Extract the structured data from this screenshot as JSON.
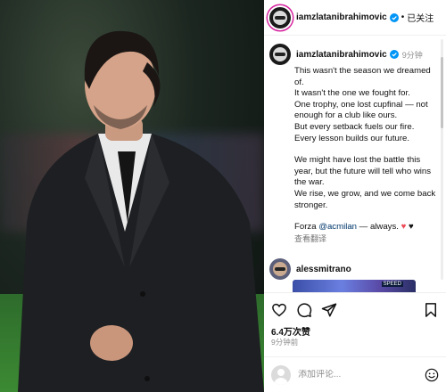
{
  "header": {
    "username": "iamzlatanibrahimovic",
    "separator": "•",
    "follow_label": "已关注"
  },
  "caption": {
    "username": "iamzlatanibrahimovic",
    "time_ago": "9分钟",
    "lines": [
      "This wasn't the season we dreamed of.",
      "It wasn't the one we fought for.",
      "One trophy, one lost cupfinal — not enough for a club like ours.",
      "But every setback fuels our fire. Every lesson builds our future.",
      "We might have lost the battle this year, but the future will tell who wins the war.",
      "We rise, we grow, and we come back stronger."
    ],
    "closing_prefix": "Forza ",
    "closing_mention": "@acmilan",
    "closing_suffix": " — always. ",
    "heart_red": "♥",
    "heart_black": "♥",
    "translate_label": "查看翻译"
  },
  "comment": {
    "username": "alessmitrano"
  },
  "stats": {
    "likes": "6.4万次赞",
    "posted_ago": "9分钟前"
  },
  "composer": {
    "placeholder": "添加评论..."
  },
  "icons": {
    "like": "heart-icon",
    "comment": "comment-icon",
    "share": "share-icon",
    "save": "bookmark-icon",
    "emoji": "emoji-icon",
    "verified": "verified-badge-icon"
  },
  "colors": {
    "verified": "#0095f6",
    "mention": "#00376b",
    "heart_red": "#ed4956",
    "muted": "#8e8e8e",
    "story_ring": "#d6249f"
  }
}
